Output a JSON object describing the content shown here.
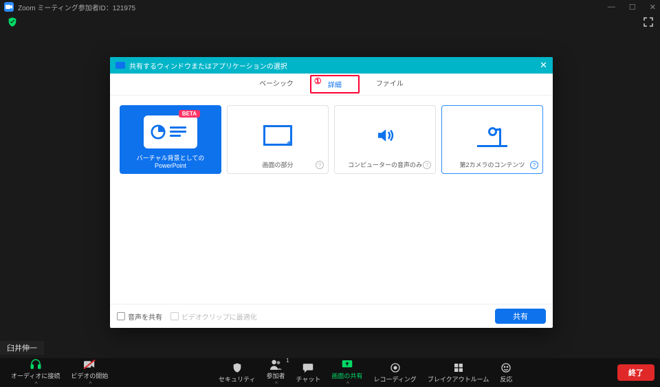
{
  "titlebar": {
    "title": "Zoom ミーティング参加者ID：121975"
  },
  "dialog": {
    "title": "共有するウィンドウまたはアプリケーションの選択",
    "tabs": {
      "basic": "ベーシック",
      "advanced": "詳細",
      "files": "ファイル",
      "marker": "①"
    },
    "options": {
      "ppt_bg": {
        "label": "バーチャル背景としてのPowerPoint",
        "badge": "BETA"
      },
      "portion": {
        "label": "画面の部分"
      },
      "audio_only": {
        "label": "コンピューターの音声のみ"
      },
      "second_cam": {
        "label": "第2カメラのコンテンツ"
      }
    },
    "footer": {
      "share_audio": "音声を共有",
      "optimize_video": "ビデオクリップに最適化",
      "share_btn": "共有"
    }
  },
  "participant": "臼井伸一",
  "toolbar": {
    "audio": "オーディオに接続",
    "video": "ビデオの開始",
    "security": "セキュリティ",
    "participants": "参加者",
    "participant_count": "1",
    "chat": "チャット",
    "share": "画面の共有",
    "record": "レコーディング",
    "breakout": "ブレイクアウトルーム",
    "reactions": "反応",
    "end": "終了"
  }
}
